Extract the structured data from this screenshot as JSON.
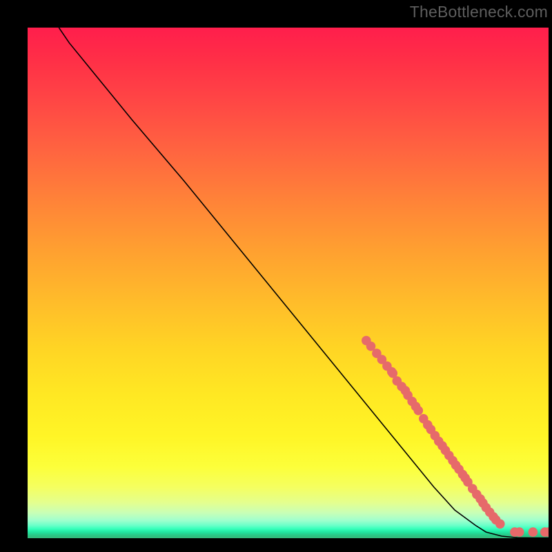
{
  "attribution": "TheBottleneck.com",
  "chart_data": {
    "type": "line",
    "title": "",
    "xlabel": "",
    "ylabel": "",
    "xlim": [
      0,
      100
    ],
    "ylim": [
      0,
      100
    ],
    "series": [
      {
        "name": "curve",
        "x": [
          6,
          8,
          12,
          20,
          30,
          40,
          50,
          60,
          70,
          78,
          82,
          86,
          88,
          91,
          94,
          97,
          100
        ],
        "y": [
          100,
          97,
          92,
          82,
          70,
          57.5,
          45,
          32.5,
          20,
          10,
          5.5,
          2.5,
          1.2,
          0.4,
          0.1,
          0.05,
          0.05
        ]
      }
    ],
    "markers": [
      {
        "x": 65.0,
        "y": 38.7
      },
      {
        "x": 65.9,
        "y": 37.6
      },
      {
        "x": 67.0,
        "y": 36.2
      },
      {
        "x": 68.0,
        "y": 35.0
      },
      {
        "x": 69.0,
        "y": 33.7
      },
      {
        "x": 69.9,
        "y": 32.6
      },
      {
        "x": 70.1,
        "y": 32.3
      },
      {
        "x": 70.9,
        "y": 30.8
      },
      {
        "x": 71.8,
        "y": 29.7
      },
      {
        "x": 72.5,
        "y": 28.9
      },
      {
        "x": 73.0,
        "y": 28.0
      },
      {
        "x": 73.8,
        "y": 26.8
      },
      {
        "x": 74.5,
        "y": 25.8
      },
      {
        "x": 75.0,
        "y": 25.0
      },
      {
        "x": 76.0,
        "y": 23.4
      },
      {
        "x": 76.8,
        "y": 22.2
      },
      {
        "x": 77.4,
        "y": 21.3
      },
      {
        "x": 78.2,
        "y": 20.1
      },
      {
        "x": 78.9,
        "y": 19.0
      },
      {
        "x": 79.6,
        "y": 18.1
      },
      {
        "x": 80.2,
        "y": 17.2
      },
      {
        "x": 80.9,
        "y": 16.2
      },
      {
        "x": 81.6,
        "y": 15.2
      },
      {
        "x": 82.2,
        "y": 14.3
      },
      {
        "x": 82.8,
        "y": 13.5
      },
      {
        "x": 83.5,
        "y": 12.5
      },
      {
        "x": 84.0,
        "y": 11.8
      },
      {
        "x": 84.5,
        "y": 11.0
      },
      {
        "x": 85.4,
        "y": 9.7
      },
      {
        "x": 86.2,
        "y": 8.6
      },
      {
        "x": 86.9,
        "y": 7.7
      },
      {
        "x": 87.4,
        "y": 6.9
      },
      {
        "x": 88.0,
        "y": 6.0
      },
      {
        "x": 88.7,
        "y": 5.1
      },
      {
        "x": 89.4,
        "y": 4.2
      },
      {
        "x": 89.9,
        "y": 3.6
      },
      {
        "x": 90.7,
        "y": 2.8
      },
      {
        "x": 93.5,
        "y": 1.2
      },
      {
        "x": 94.4,
        "y": 1.2
      },
      {
        "x": 97.0,
        "y": 1.2
      },
      {
        "x": 99.3,
        "y": 1.2
      },
      {
        "x": 100.0,
        "y": 1.2
      }
    ],
    "marker_color": "#e66a6a",
    "line_color": "#000000"
  }
}
